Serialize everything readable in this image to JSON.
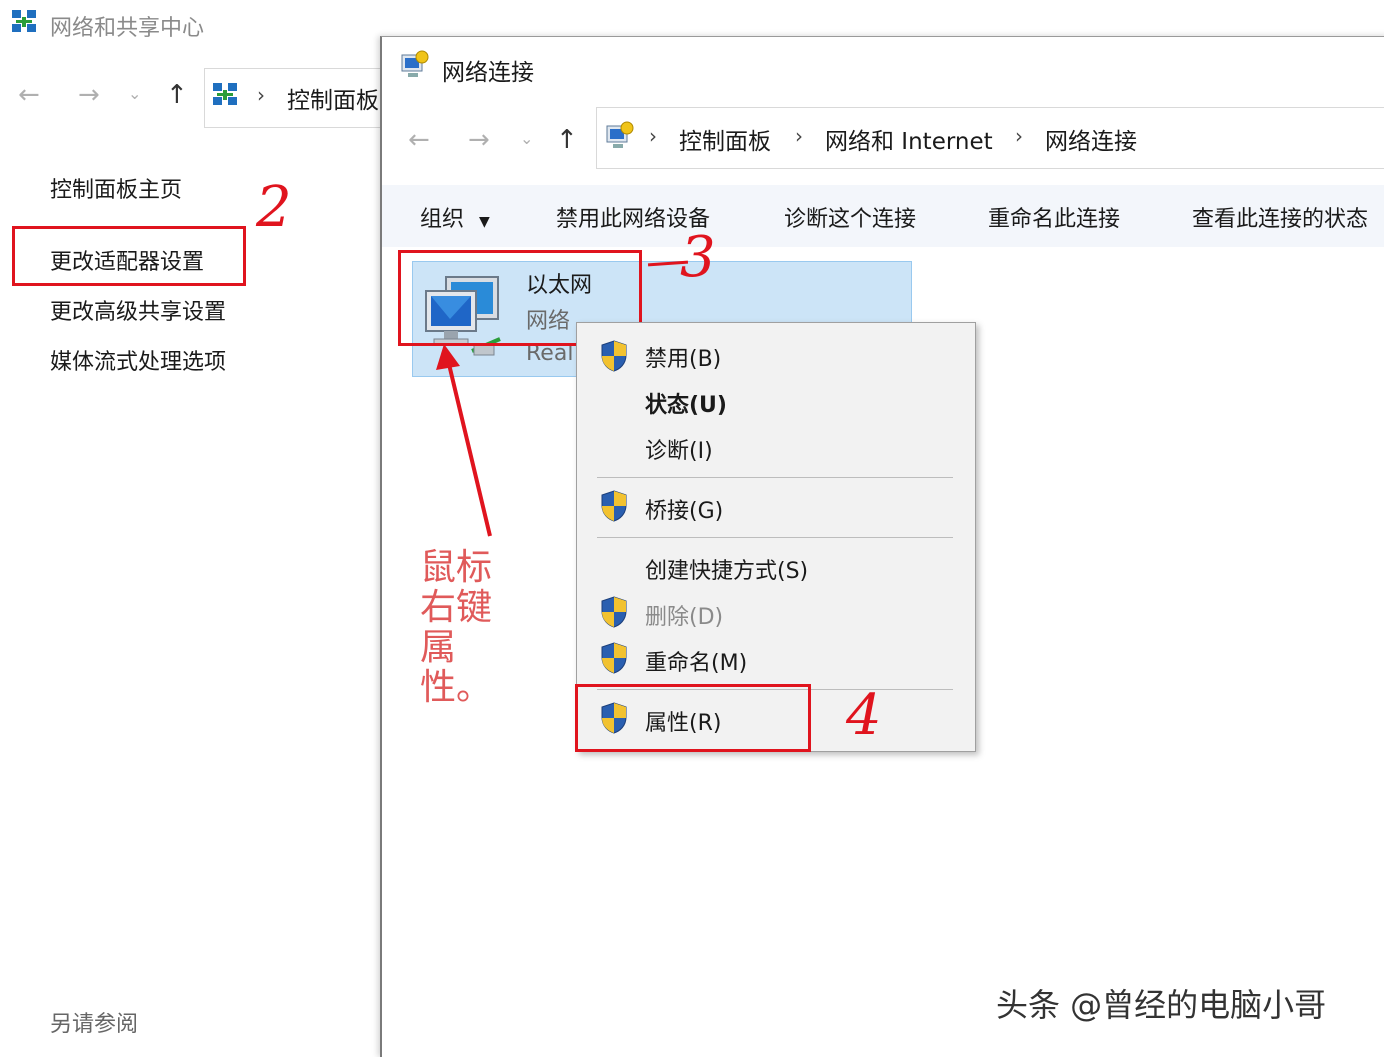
{
  "back_window": {
    "title": "网络和共享中心",
    "address": {
      "root": "控制面板"
    },
    "sidebar": {
      "items": [
        {
          "label": "控制面板主页"
        },
        {
          "label": "更改适配器设置"
        },
        {
          "label": "更改高级共享设置"
        },
        {
          "label": "媒体流式处理选项"
        }
      ],
      "see_also": "另请参阅"
    }
  },
  "front_window": {
    "title": "网络连接",
    "address": {
      "segments": [
        "控制面板",
        "网络和 Internet",
        "网络连接"
      ]
    },
    "commands": [
      "组织",
      "禁用此网络设备",
      "诊断这个连接",
      "重命名此连接",
      "查看此连接的状态"
    ],
    "connection": {
      "name": "以太网",
      "status": "网络",
      "adapter": "Real"
    }
  },
  "context_menu": {
    "items": [
      {
        "label": "禁用(B)",
        "shield": true
      },
      {
        "label": "状态(U)",
        "shield": false,
        "default": true
      },
      {
        "label": "诊断(I)",
        "shield": false
      },
      {
        "label": "桥接(G)",
        "shield": true
      },
      {
        "label": "创建快捷方式(S)",
        "shield": false
      },
      {
        "label": "删除(D)",
        "shield": true,
        "disabled": true
      },
      {
        "label": "重命名(M)",
        "shield": true
      },
      {
        "label": "属性(R)",
        "shield": true
      }
    ]
  },
  "annotations": {
    "step2": "2",
    "step3": "3",
    "step4": "4",
    "note": "鼠标右键属性。"
  },
  "watermark": "头条 @曾经的电脑小哥",
  "colors": {
    "annotation_red": "#e0141e",
    "selection": "#cce4f7",
    "menu_bg": "#f2f2f2"
  }
}
